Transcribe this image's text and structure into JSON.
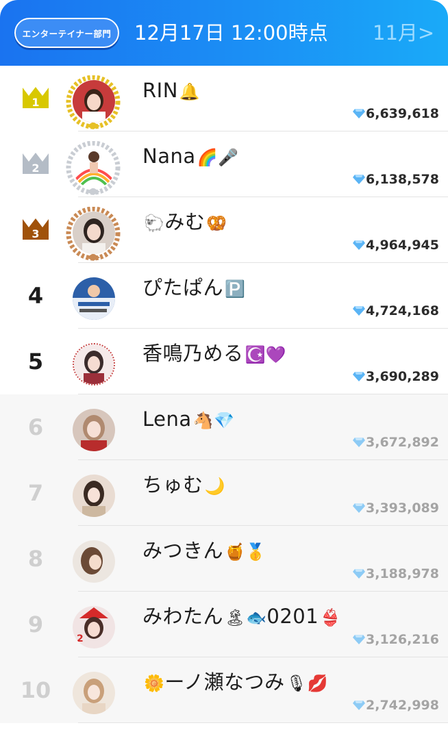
{
  "header": {
    "category_label": "エンターテイナー部門",
    "datetime": "12月17日 12:00時点",
    "month_link": "11月>"
  },
  "colors": {
    "header_gradient": [
      "#1a73f0",
      "#1aaaf8"
    ],
    "gold": "#d8c800",
    "silver": "#b4bcc6",
    "bronze": "#a0520a"
  },
  "ranking": [
    {
      "rank": "1",
      "name": "RIN",
      "emoji": "🔔",
      "score": "6,639,618",
      "crown": "gold",
      "highlight": true
    },
    {
      "rank": "2",
      "name": "Nana",
      "emoji": "🌈🎤",
      "score": "6,138,578",
      "crown": "silver",
      "highlight": true
    },
    {
      "rank": "3",
      "name": "みむ",
      "lead_emoji": "🐑",
      "emoji": "🥨",
      "score": "4,964,945",
      "crown": "bronze",
      "highlight": true
    },
    {
      "rank": "4",
      "name": "ぴたぱん",
      "emoji": "🅿️",
      "score": "4,724,168",
      "crown": null,
      "highlight": true
    },
    {
      "rank": "5",
      "name": "香鳴乃める",
      "emoji": "☪️💜",
      "score": "3,690,289",
      "crown": null,
      "highlight": true
    },
    {
      "rank": "6",
      "name": "Lena",
      "emoji": "🐴💎",
      "score": "3,672,892",
      "crown": null,
      "highlight": false
    },
    {
      "rank": "7",
      "name": "ちゅむ",
      "emoji": "🌙",
      "score": "3,393,089",
      "crown": null,
      "highlight": false
    },
    {
      "rank": "8",
      "name": "みつきん",
      "emoji": "🍯🥇",
      "score": "3,188,978",
      "crown": null,
      "highlight": false
    },
    {
      "rank": "9",
      "name": "みわたん",
      "emoji": "🏝🐟",
      "suffix": "0201",
      "suffix_emoji": "👙",
      "score": "3,126,216",
      "crown": null,
      "highlight": false
    },
    {
      "rank": "10",
      "name": "ーノ瀬なつみ",
      "lead_emoji": "🌼",
      "emoji": "🎙💋",
      "score": "2,742,998",
      "crown": null,
      "highlight": false
    }
  ]
}
